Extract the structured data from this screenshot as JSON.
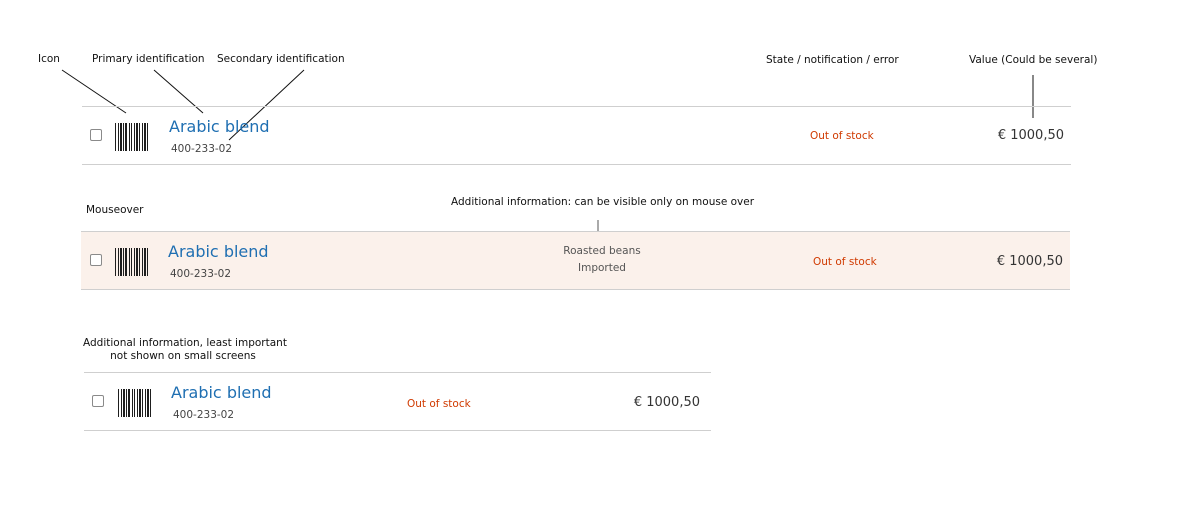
{
  "annotations": {
    "icon": "Icon",
    "primary_identification": "Primary identification",
    "secondary_identification": "Secondary identification",
    "state": "State / notification / error",
    "value": "Value (Could be several)",
    "mouseover": "Mouseover",
    "additional_info_mouseover": "Additional information: can be visible only on mouse over",
    "additional_info_small_line1": "Additional information, least important",
    "additional_info_small_line2": "not shown on small screens"
  },
  "rows": [
    {
      "variant": "default",
      "icon": "barcode-icon",
      "primary": "Arabic blend",
      "secondary": "400-233-02",
      "state": "Out of stock",
      "value": "€ 1000,50"
    },
    {
      "variant": "mouseover",
      "icon": "barcode-icon",
      "primary": "Arabic blend",
      "secondary": "400-233-02",
      "extra_line1": "Roasted beans",
      "extra_line2": "Imported",
      "state": "Out of stock",
      "value": "€ 1000,50"
    },
    {
      "variant": "small-screen",
      "icon": "barcode-icon",
      "primary": "Arabic blend",
      "secondary": "400-233-02",
      "state": "Out of stock",
      "value": "€ 1000,50"
    }
  ],
  "colors": {
    "primary_link": "#1f6fb2",
    "state_error": "#d03a00",
    "hover_background": "#fbf1eb",
    "divider": "#cfcfcf"
  }
}
